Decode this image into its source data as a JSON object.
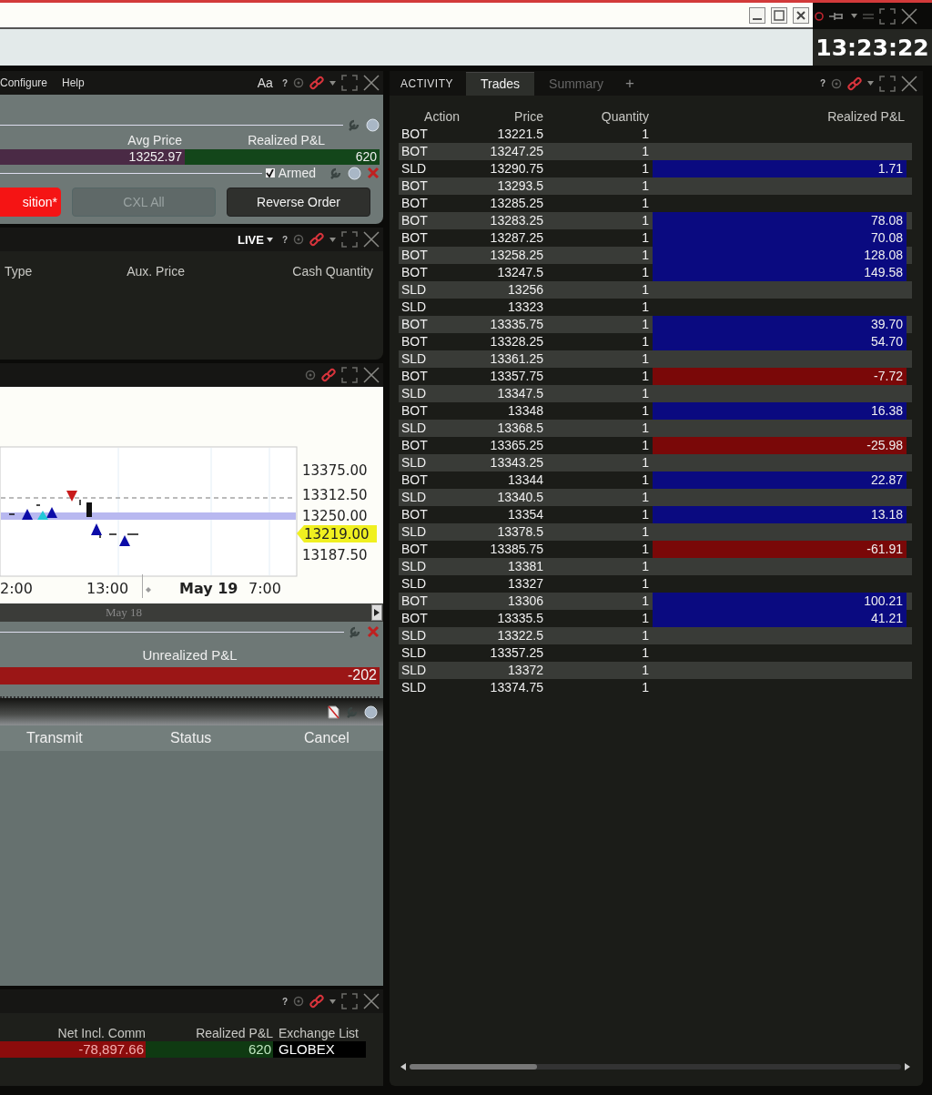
{
  "clock": "13:23:22",
  "order_panel": {
    "menu": [
      "Configure",
      "Help"
    ],
    "font_button": "Aa",
    "help": "?",
    "columns": [
      "Avg Price",
      "Realized P&L"
    ],
    "values": [
      {
        "text": "13252.97",
        "color": "#4a2a45"
      },
      {
        "text": "620",
        "color": "#13461a"
      }
    ],
    "armed": {
      "label": "Armed",
      "checked": true
    },
    "buttons": [
      {
        "label": "sition*",
        "kind": "danger",
        "disabled": false
      },
      {
        "label": "CXL All",
        "kind": "plain",
        "disabled": true
      },
      {
        "label": "Reverse Order",
        "kind": "dark",
        "disabled": false
      }
    ]
  },
  "orders_panel": {
    "mode": "LIVE",
    "help": "?",
    "columns": [
      "Type",
      "Aux. Price",
      "Cash Quantity"
    ]
  },
  "chart_panel": {
    "y_labels": [
      "13375.00",
      "13312.50",
      "13250.00",
      "13187.50"
    ],
    "last_price": "13219.00",
    "x_labels": [
      "2:00",
      "13:00"
    ],
    "date_label": "May 19",
    "time_label": "7:00",
    "scroll_label": "May 18",
    "pnl_header": "Unrealized P&L",
    "pnl_value": "-202"
  },
  "transmit_panel": {
    "columns": [
      "Transmit",
      "Status",
      "Cancel"
    ]
  },
  "portfolio_panel": {
    "help": "?",
    "columns": [
      {
        "header": "Net Incl. Comm",
        "value": "-78,897.66",
        "color": "#8c0c0c"
      },
      {
        "header": "Realized P&L",
        "value": "620",
        "color": "#0f3a12"
      },
      {
        "header": "Exchange List",
        "value": "GLOBEX",
        "color": "#000000"
      }
    ]
  },
  "activity": {
    "label": "ACTIVITY",
    "tabs": [
      {
        "label": "Trades",
        "selected": true
      },
      {
        "label": "Summary",
        "selected": false
      }
    ],
    "add": "+",
    "help": "?",
    "columns": [
      "Action",
      "Price",
      "Quantity",
      "Realized P&L"
    ],
    "rows": [
      {
        "action": "BOT",
        "price": "13221.5",
        "quantity": "1"
      },
      {
        "action": "BOT",
        "price": "13247.25",
        "quantity": "1"
      },
      {
        "action": "SLD",
        "price": "13290.75",
        "quantity": "1",
        "pnl": "1.71",
        "color": "#0a0a80"
      },
      {
        "action": "BOT",
        "price": "13293.5",
        "quantity": "1"
      },
      {
        "action": "BOT",
        "price": "13285.25",
        "quantity": "1"
      },
      {
        "action": "BOT",
        "price": "13283.25",
        "quantity": "1",
        "pnl": "78.08",
        "color": "#0a0a80"
      },
      {
        "action": "BOT",
        "price": "13287.25",
        "quantity": "1",
        "pnl": "70.08",
        "color": "#0a0a80"
      },
      {
        "action": "BOT",
        "price": "13258.25",
        "quantity": "1",
        "pnl": "128.08",
        "color": "#0a0a80"
      },
      {
        "action": "BOT",
        "price": "13247.5",
        "quantity": "1",
        "pnl": "149.58",
        "color": "#0a0a80"
      },
      {
        "action": "SLD",
        "price": "13256",
        "quantity": "1"
      },
      {
        "action": "SLD",
        "price": "13323",
        "quantity": "1"
      },
      {
        "action": "BOT",
        "price": "13335.75",
        "quantity": "1",
        "pnl": "39.70",
        "color": "#0a0a80"
      },
      {
        "action": "BOT",
        "price": "13328.25",
        "quantity": "1",
        "pnl": "54.70",
        "color": "#0a0a80"
      },
      {
        "action": "SLD",
        "price": "13361.25",
        "quantity": "1"
      },
      {
        "action": "BOT",
        "price": "13357.75",
        "quantity": "1",
        "pnl": "-7.72",
        "color": "#7a0808"
      },
      {
        "action": "SLD",
        "price": "13347.5",
        "quantity": "1"
      },
      {
        "action": "BOT",
        "price": "13348",
        "quantity": "1",
        "pnl": "16.38",
        "color": "#0a0a80"
      },
      {
        "action": "SLD",
        "price": "13368.5",
        "quantity": "1"
      },
      {
        "action": "BOT",
        "price": "13365.25",
        "quantity": "1",
        "pnl": "-25.98",
        "color": "#7a0808"
      },
      {
        "action": "SLD",
        "price": "13343.25",
        "quantity": "1"
      },
      {
        "action": "BOT",
        "price": "13344",
        "quantity": "1",
        "pnl": "22.87",
        "color": "#0a0a80"
      },
      {
        "action": "SLD",
        "price": "13340.5",
        "quantity": "1"
      },
      {
        "action": "BOT",
        "price": "13354",
        "quantity": "1",
        "pnl": "13.18",
        "color": "#0a0a80"
      },
      {
        "action": "SLD",
        "price": "13378.5",
        "quantity": "1"
      },
      {
        "action": "BOT",
        "price": "13385.75",
        "quantity": "1",
        "pnl": "-61.91",
        "color": "#7a0808"
      },
      {
        "action": "SLD",
        "price": "13381",
        "quantity": "1"
      },
      {
        "action": "SLD",
        "price": "13327",
        "quantity": "1"
      },
      {
        "action": "BOT",
        "price": "13306",
        "quantity": "1",
        "pnl": "100.21",
        "color": "#0a0a80"
      },
      {
        "action": "BOT",
        "price": "13335.5",
        "quantity": "1",
        "pnl": "41.21",
        "color": "#0a0a80"
      },
      {
        "action": "SLD",
        "price": "13322.5",
        "quantity": "1"
      },
      {
        "action": "SLD",
        "price": "13357.25",
        "quantity": "1"
      },
      {
        "action": "SLD",
        "price": "13372",
        "quantity": "1"
      },
      {
        "action": "SLD",
        "price": "13374.75",
        "quantity": "1"
      }
    ]
  }
}
